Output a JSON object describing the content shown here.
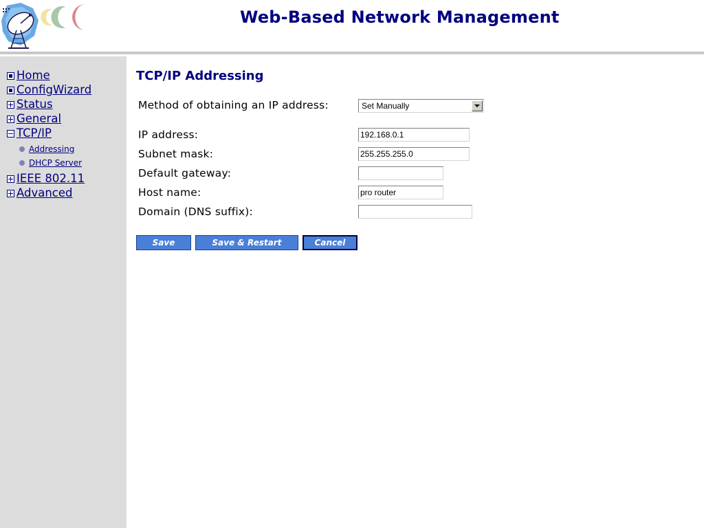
{
  "header": {
    "title": "Web-Based Network Management"
  },
  "sidebar": {
    "items": [
      {
        "label": "Home",
        "icon": "dot-box-icon"
      },
      {
        "label": "ConfigWizard",
        "icon": "dot-box-icon"
      },
      {
        "label": "Status",
        "icon": "expand-plus-icon"
      },
      {
        "label": "General",
        "icon": "expand-plus-icon"
      },
      {
        "label": "TCP/IP",
        "icon": "collapse-minus-icon"
      },
      {
        "label": "IEEE 802.11",
        "icon": "expand-plus-icon"
      },
      {
        "label": "Advanced",
        "icon": "expand-plus-icon"
      }
    ],
    "subitems": [
      {
        "label": "Addressing"
      },
      {
        "label": "DHCP Server"
      }
    ]
  },
  "main": {
    "title": "TCP/IP Addressing",
    "method": {
      "label": "Method of obtaining an IP address:",
      "selected": "Set Manually"
    },
    "fields": [
      {
        "label": "IP address:",
        "value": "192.168.0.1"
      },
      {
        "label": "Subnet mask:",
        "value": "255.255.255.0"
      },
      {
        "label": "Default gateway:",
        "value": ""
      },
      {
        "label": "Host name:",
        "value": "pro router"
      },
      {
        "label": "Domain (DNS suffix):",
        "value": ""
      }
    ],
    "buttons": {
      "save": "Save",
      "save_restart": "Save & Restart",
      "cancel": "Cancel"
    }
  },
  "colors": {
    "brand": "#000080",
    "sidebar_bg": "#dcdcdc",
    "button_bg": "#4a7fd8"
  }
}
